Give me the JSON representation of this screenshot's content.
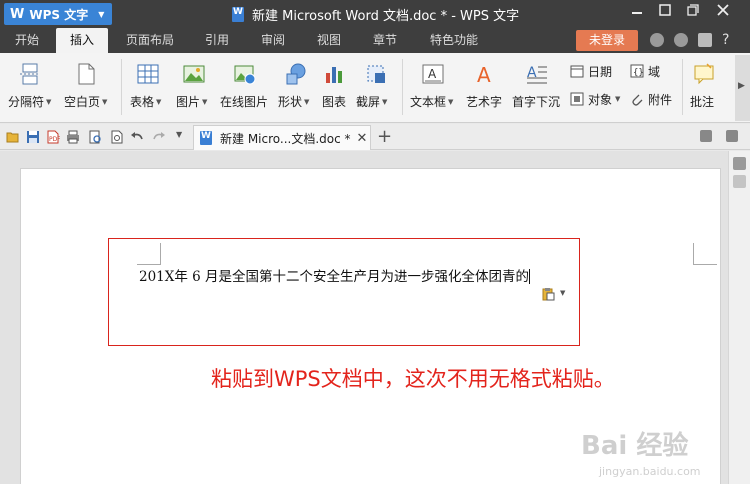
{
  "titlebar": {
    "app_name": "WPS 文字",
    "window_title": "新建 Microsoft Word 文档.doc * - WPS 文字",
    "controls": [
      "minimize-icon",
      "maximize-icon",
      "close-icon"
    ]
  },
  "menu": {
    "tabs": [
      "开始",
      "插入",
      "页面布局",
      "引用",
      "审阅",
      "视图",
      "章节",
      "特色功能"
    ],
    "active_tab": "插入",
    "login_label": "未登录"
  },
  "ribbon": {
    "large_buttons": [
      {
        "label": "分隔符",
        "icon": "page-break-icon",
        "dropdown": true
      },
      {
        "label": "空白页",
        "icon": "blank-page-icon",
        "dropdown": true
      },
      {
        "label": "表格",
        "icon": "table-icon",
        "dropdown": true
      },
      {
        "label": "图片",
        "icon": "picture-icon",
        "dropdown": true
      },
      {
        "label": "在线图片",
        "icon": "online-picture-icon",
        "dropdown": false
      },
      {
        "label": "形状",
        "icon": "shapes-icon",
        "dropdown": true
      },
      {
        "label": "图表",
        "icon": "chart-icon",
        "dropdown": false
      },
      {
        "label": "截屏",
        "icon": "screenshot-icon",
        "dropdown": true
      },
      {
        "label": "文本框",
        "icon": "textbox-icon",
        "dropdown": true
      },
      {
        "label": "艺术字",
        "icon": "wordart-icon",
        "dropdown": false
      },
      {
        "label": "首字下沉",
        "icon": "drop-cap-icon",
        "dropdown": false
      },
      {
        "label": "批注",
        "icon": "comment-icon",
        "dropdown": false
      }
    ],
    "small_buttons": [
      {
        "label": "日期",
        "icon": "date-icon",
        "dropdown": false
      },
      {
        "label": "域",
        "icon": "field-icon",
        "dropdown": false
      },
      {
        "label": "对象",
        "icon": "object-icon",
        "dropdown": true
      },
      {
        "label": "附件",
        "icon": "attachment-icon",
        "dropdown": false
      }
    ]
  },
  "doc_tabs": {
    "tab_label": "新建 Micro...文档.doc *",
    "close_glyph": "✕",
    "add_glyph": "+"
  },
  "document": {
    "text": "201X年 6 月是全国第十二个安全生产月为进一步强化全体团青的"
  },
  "annotation": {
    "text": "粘贴到WPS文档中，这次不用无格式粘贴。"
  },
  "watermark": {
    "brand": "Bai 经验",
    "url": "jingyan.baidu.com"
  },
  "colors": {
    "titlebar_bg": "#3e3e3e",
    "app_button": "#3a84d6",
    "login_button": "#e57a52",
    "annotation": "#e3241c",
    "selection_border": "#d9241d"
  }
}
